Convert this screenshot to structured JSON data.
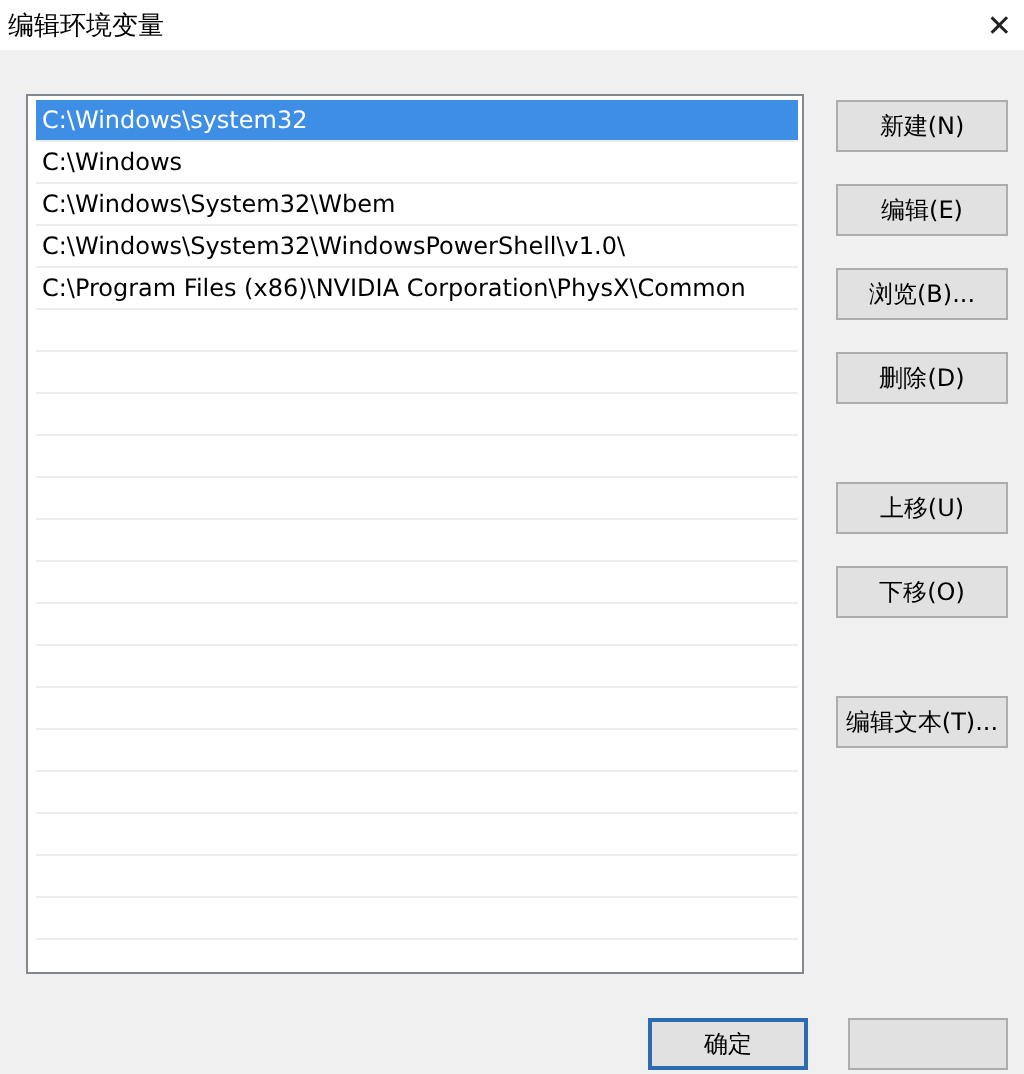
{
  "window": {
    "title": "编辑环境变量",
    "close": "✕"
  },
  "paths": [
    {
      "text": "C:\\Windows\\system32",
      "selected": true
    },
    {
      "text": "C:\\Windows",
      "selected": false
    },
    {
      "text": "C:\\Windows\\System32\\Wbem",
      "selected": false
    },
    {
      "text": "C:\\Windows\\System32\\WindowsPowerShell\\v1.0\\",
      "selected": false
    },
    {
      "text": "C:\\Program Files (x86)\\NVIDIA Corporation\\PhysX\\Common",
      "selected": false
    }
  ],
  "button_groups": [
    [
      "新建(N)",
      "编辑(E)",
      "浏览(B)...",
      "删除(D)"
    ],
    [
      "上移(U)",
      "下移(O)"
    ],
    [
      "编辑文本(T)..."
    ]
  ],
  "footer": {
    "ok": "确定"
  }
}
